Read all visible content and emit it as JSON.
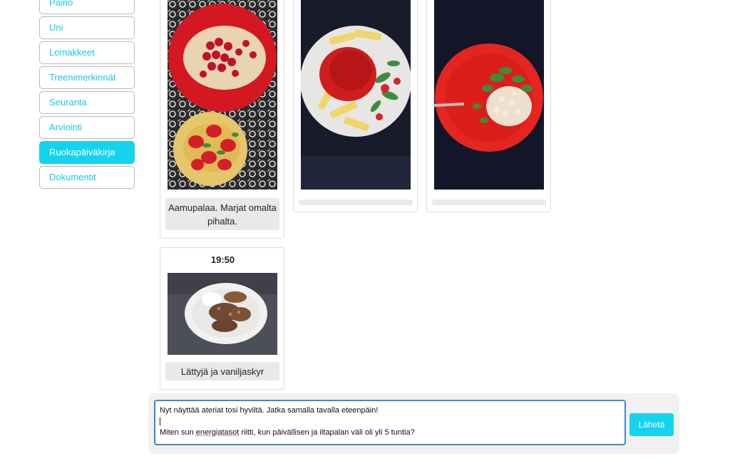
{
  "sidebar": {
    "items": [
      {
        "label": "Paino",
        "active": false
      },
      {
        "label": "Uni",
        "active": false
      },
      {
        "label": "Lomakkeet",
        "active": false
      },
      {
        "label": "Treenimerkinnät",
        "active": false
      },
      {
        "label": "Seuranta",
        "active": false
      },
      {
        "label": "Arviointi",
        "active": false
      },
      {
        "label": "Ruokapäiväkirja",
        "active": true
      },
      {
        "label": "Dokumentit",
        "active": false
      }
    ]
  },
  "meals": [
    {
      "caption": "Aamupalaa. Marjat omalta pihalta.",
      "image": "berries-and-toast-photo"
    },
    {
      "caption": "",
      "image": "pasta-with-tomato-sauce-photo"
    },
    {
      "caption": "",
      "image": "rice-with-salad-photo"
    },
    {
      "time": "19:50",
      "caption": "Lättyjä ja vaniljaskyr",
      "image": "pancakes-photo"
    }
  ],
  "chat": {
    "message_line1": "Nyt näyttää ateriat tosi hyviltä. Jatka samalla tavalla eteenpäin!",
    "message_line3_pre": "Miten sun ",
    "message_line3_word": "energiatasot",
    "message_line3_post": " riitti, kun päivällisen ja iltapalan väli oli yli 5 tuntia?",
    "send_label": "Lähetä"
  },
  "colors": {
    "accent": "#14d3ee",
    "focus_border": "#3f86d4"
  }
}
